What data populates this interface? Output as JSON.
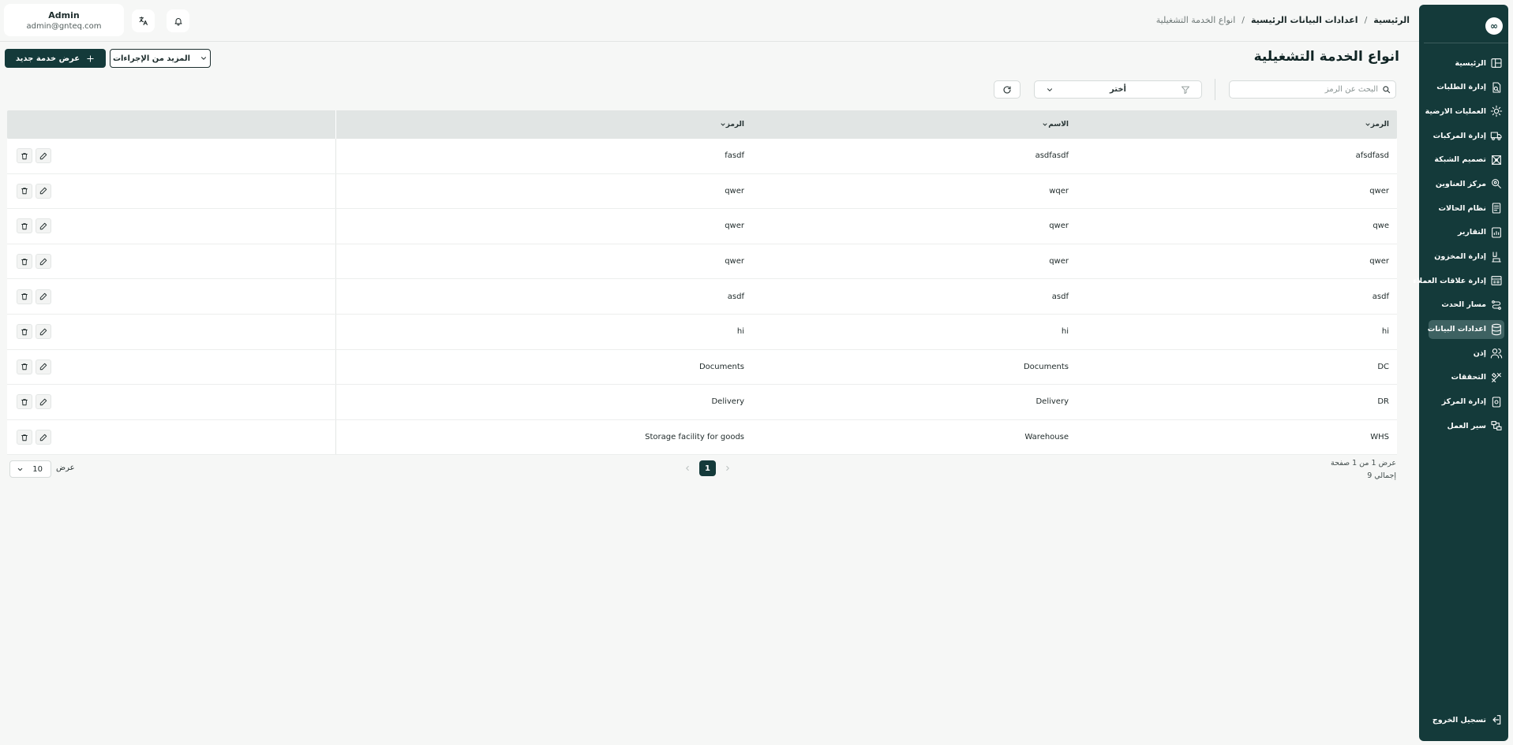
{
  "user": {
    "name": "Admin",
    "email": "admin@gnteq.com"
  },
  "breadcrumb": {
    "home": "الرئيسية",
    "section": "اعدادات البيانات الرئيسية",
    "current": "انواع الخدمة التشغيلية"
  },
  "page": {
    "title": "انواع الخدمة التشغيلية"
  },
  "actions": {
    "add_label": "عرض خدمة جديد",
    "more_label": "المزيد من الإجراءات"
  },
  "toolbar": {
    "search_placeholder": "البحث عن الرمز",
    "filter_placeholder": "أختر"
  },
  "table": {
    "headers": {
      "code": "الرمز",
      "name": "الاسم",
      "description": "الرمز"
    },
    "rows": [
      {
        "code": "afsdfasd",
        "name": "asdfasdf",
        "description": "fasdf"
      },
      {
        "code": "qwer",
        "name": "wqer",
        "description": "qwer"
      },
      {
        "code": "qwe",
        "name": "qwer",
        "description": "qwer"
      },
      {
        "code": "qwer",
        "name": "qwer",
        "description": "qwer"
      },
      {
        "code": "asdf",
        "name": "asdf",
        "description": "asdf"
      },
      {
        "code": "hi",
        "name": "hi",
        "description": "hi"
      },
      {
        "code": "DC",
        "name": "Documents",
        "description": "Documents"
      },
      {
        "code": "DR",
        "name": "Delivery",
        "description": "Delivery"
      },
      {
        "code": "WHS",
        "name": "Warehouse",
        "description": "Storage facility for goods"
      }
    ]
  },
  "pagination": {
    "page_info": "عرض 1 من 1 صفحة",
    "total": "إجمالي 9",
    "current_page": "1",
    "page_size_label": "عرض",
    "page_size": "10"
  },
  "sidebar": {
    "logo": "∞",
    "items": [
      {
        "label": "الرئيسية",
        "icon": "layout-icon"
      },
      {
        "label": "إدارة الطلبات",
        "icon": "order-icon"
      },
      {
        "label": "العمليات الارضية",
        "icon": "sun-gear-icon"
      },
      {
        "label": "إدارة المركبات",
        "icon": "truck-icon"
      },
      {
        "label": "تصميم الشبكة",
        "icon": "network-icon"
      },
      {
        "label": "مركز العناوين",
        "icon": "location-icon"
      },
      {
        "label": "نظام الحالات",
        "icon": "status-icon"
      },
      {
        "label": "التقارير",
        "icon": "report-icon"
      },
      {
        "label": "إدارة المخزون",
        "icon": "inventory-icon"
      },
      {
        "label": "إدارة علاقات العملاء",
        "icon": "crm-icon"
      },
      {
        "label": "مسار الحدث",
        "icon": "route-icon"
      },
      {
        "label": "اعدادات البيانات",
        "icon": "database-icon",
        "active": true
      },
      {
        "label": "إذن",
        "icon": "users-icon"
      },
      {
        "label": "التحققات",
        "icon": "tools-icon"
      },
      {
        "label": "إدارة المركز",
        "icon": "hub-icon"
      },
      {
        "label": "سير العمل",
        "icon": "workflow-icon"
      }
    ],
    "logout_label": "تسجيل الخروج"
  },
  "colors": {
    "primary": "#143a3a",
    "active": "#3e6262",
    "background": "#f6f7f6",
    "header_row": "#e1e5e4"
  }
}
